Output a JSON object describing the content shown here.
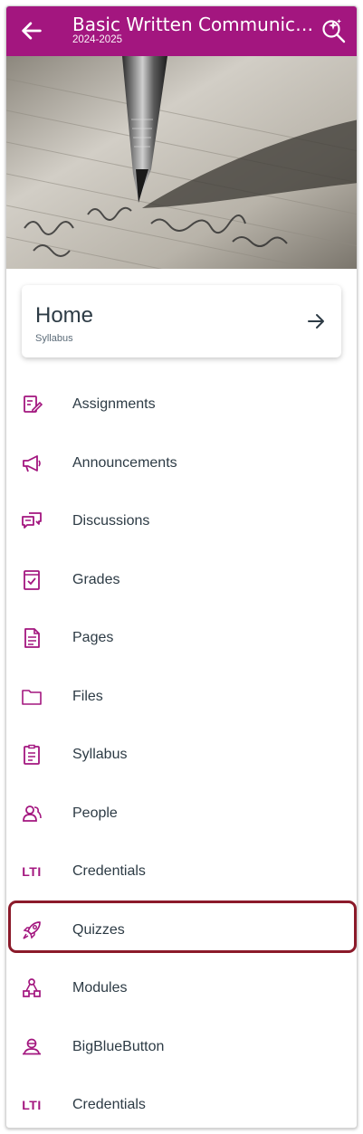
{
  "header": {
    "title": "Basic Written Communicati…",
    "term": "2024-2025",
    "back_icon": "arrow-left-icon",
    "search_icon": "search-ai-icon",
    "color": "#a3167f"
  },
  "home_card": {
    "title": "Home",
    "subtitle": "Syllabus",
    "arrow_icon": "arrow-right-icon"
  },
  "nav": {
    "items": [
      {
        "label": "Assignments",
        "icon": "assignment-icon"
      },
      {
        "label": "Announcements",
        "icon": "megaphone-icon"
      },
      {
        "label": "Discussions",
        "icon": "discussion-icon"
      },
      {
        "label": "Grades",
        "icon": "gradebook-icon"
      },
      {
        "label": "Pages",
        "icon": "document-icon"
      },
      {
        "label": "Files",
        "icon": "folder-icon"
      },
      {
        "label": "Syllabus",
        "icon": "syllabus-icon"
      },
      {
        "label": "People",
        "icon": "people-icon"
      },
      {
        "label": "Credentials",
        "icon": "lti-icon",
        "icon_text": "LTI"
      },
      {
        "label": "Quizzes",
        "icon": "rocket-icon"
      },
      {
        "label": "Modules",
        "icon": "modules-icon"
      },
      {
        "label": "BigBlueButton",
        "icon": "conference-icon"
      },
      {
        "label": "Credentials",
        "icon": "lti-icon",
        "icon_text": "LTI"
      }
    ],
    "highlighted": "Quizzes",
    "icon_color": "#a3167f",
    "highlight_color": "#8b1a2a"
  }
}
